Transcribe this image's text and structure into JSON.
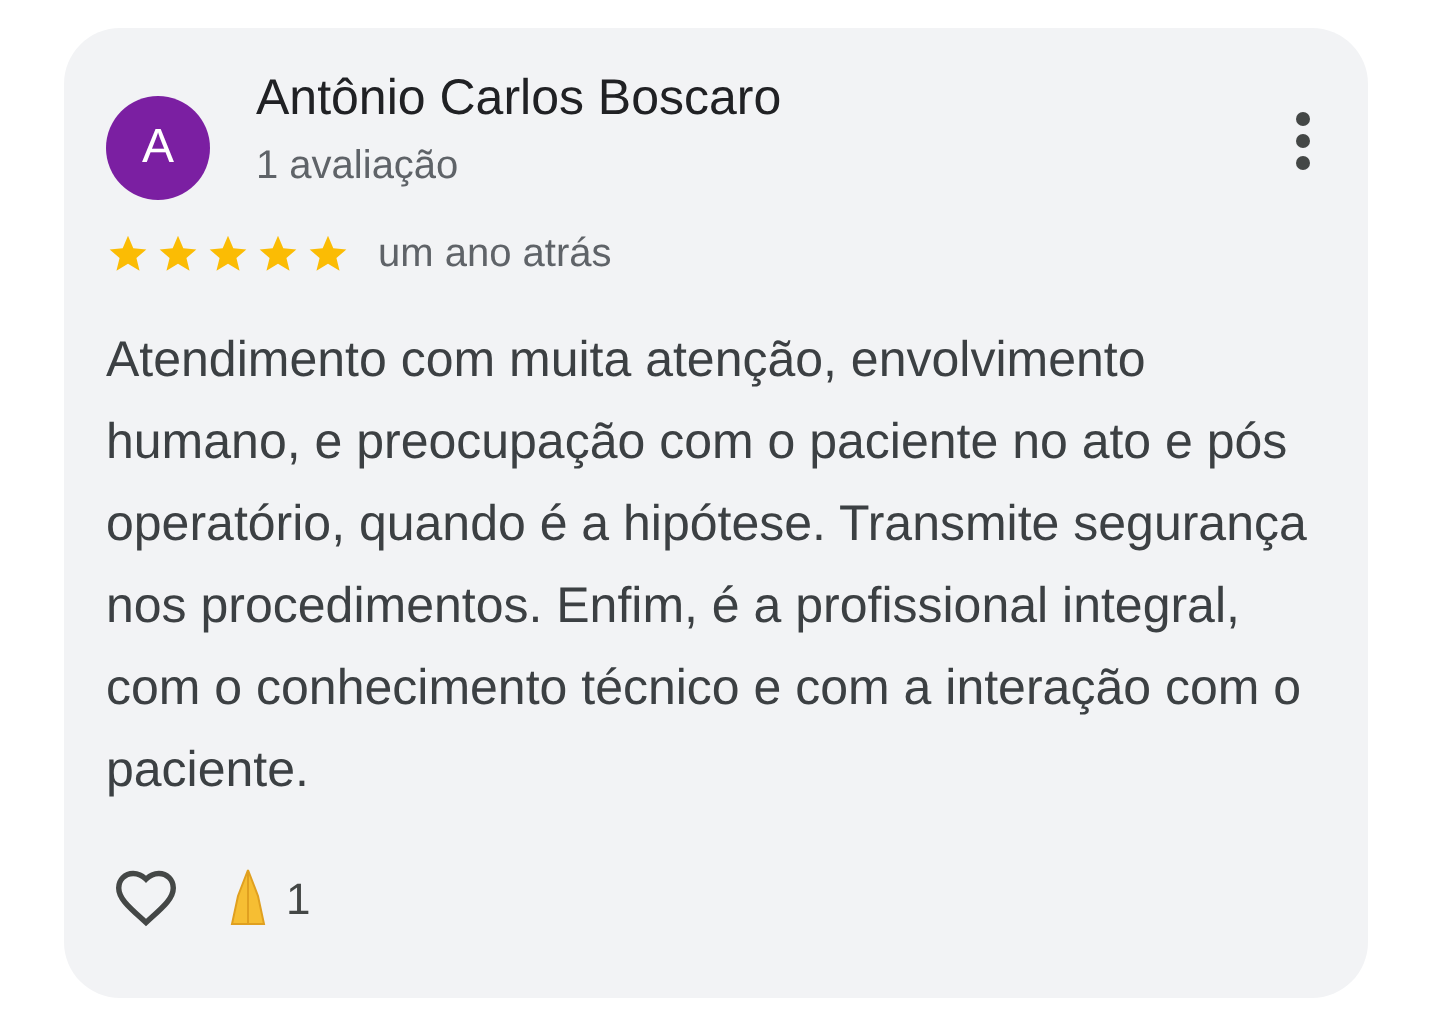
{
  "review": {
    "avatar_letter": "A",
    "author": "Antônio Carlos Boscaro",
    "author_meta": "1 avaliação",
    "stars": 5,
    "time": "um ano atrás",
    "text": "Atendimento com muita atenção, envolvimento humano, e preocupação com o paciente no ato e pós operatório, quando é a hipótese. Transmite segurança nos procedimentos. Enfim, é a profissional integral, com o conhecimento técnico e com a interação com o paciente.",
    "reactions": {
      "liked": false,
      "count": "1"
    }
  }
}
